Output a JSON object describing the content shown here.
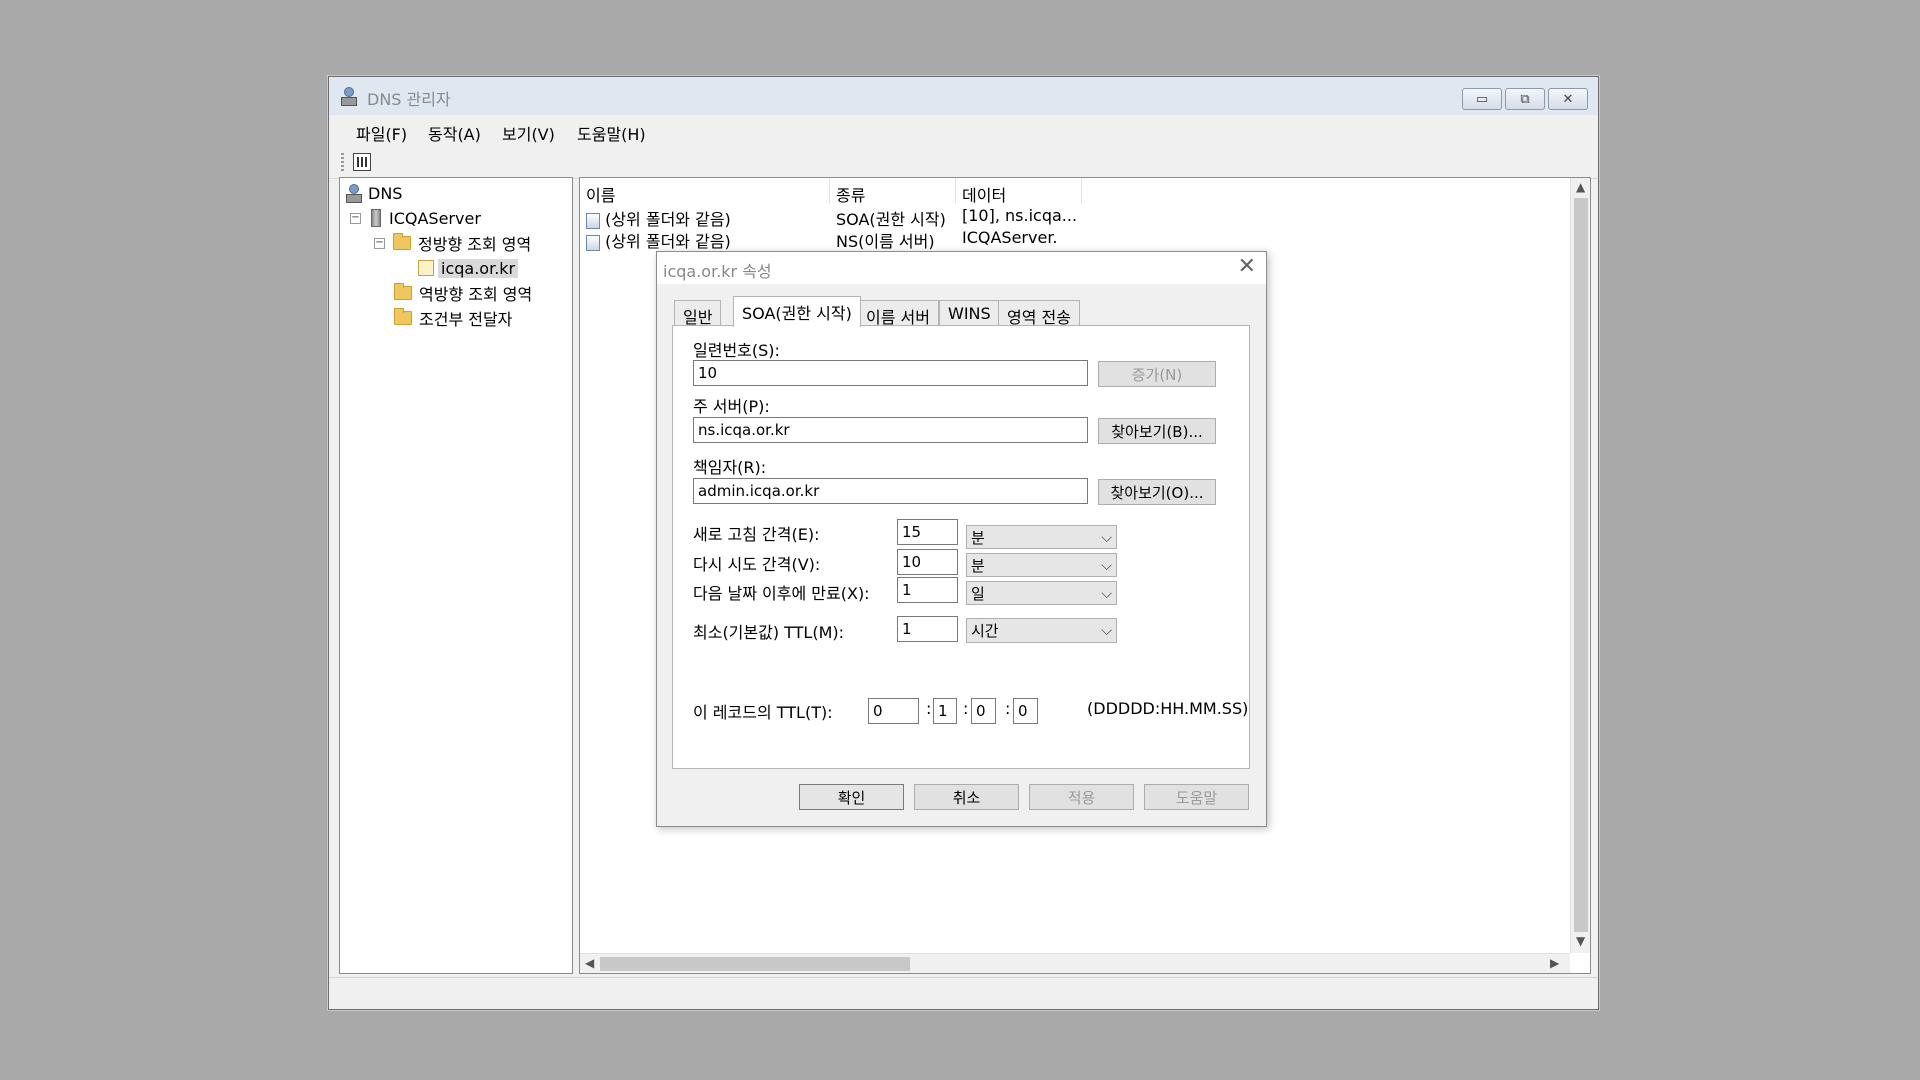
{
  "window": {
    "title": "DNS 관리자",
    "controls": {
      "minimize": "▭",
      "maximize": "⧉",
      "close": "✕"
    }
  },
  "menu": [
    "파일(F)",
    "동작(A)",
    "보기(V)",
    "도움말(H)"
  ],
  "tree": {
    "root": "DNS",
    "server": "ICQAServer",
    "forward_zones": "정방향 조회 영역",
    "selected_zone": "icqa.or.kr",
    "reverse_zones": "역방향 조회 영역",
    "conditional_forwarders": "조건부 전달자"
  },
  "list": {
    "columns": [
      "이름",
      "종류",
      "데이터"
    ],
    "rows": [
      {
        "name": "(상위 폴더와 같음)",
        "type": "SOA(권한 시작)",
        "data": "[10], ns.icqa..."
      },
      {
        "name": "(상위 폴더와 같음)",
        "type": "NS(이름 서버)",
        "data": "ICQAServer."
      }
    ]
  },
  "dialog": {
    "title": "icqa.or.kr 속성",
    "close": "✕",
    "tabs": [
      "일반",
      "SOA(권한 시작)",
      "이름 서버",
      "WINS",
      "영역 전송"
    ],
    "active_tab": "SOA(권한 시작)",
    "serial_label": "일련번호(S):",
    "serial_value": "10",
    "increment_button": "증가(N)",
    "primary_server_label": "주 서버(P):",
    "primary_server_value": "ns.icqa.or.kr",
    "browse_b_button": "찾아보기(B)...",
    "responsible_label": "책임자(R):",
    "responsible_value": "admin.icqa.or.kr",
    "browse_o_button": "찾아보기(O)...",
    "refresh_label": "새로 고침 간격(E):",
    "refresh_value": "15",
    "refresh_unit": "분",
    "retry_label": "다시 시도 간격(V):",
    "retry_value": "10",
    "retry_unit": "분",
    "expire_label": "다음 날짜 이후에 만료(X):",
    "expire_value": "1",
    "expire_unit": "일",
    "min_ttl_label": "최소(기본값) TTL(M):",
    "min_ttl_value": "1",
    "min_ttl_unit": "시간",
    "record_ttl_label": "이 레코드의 TTL(T):",
    "ttl_days": "0",
    "ttl_hours": "1",
    "ttl_minutes": "0",
    "ttl_seconds": "0",
    "ttl_sep": ":",
    "ttl_format": "(DDDDD:HH.MM.SS)",
    "ok_button": "확인",
    "cancel_button": "취소",
    "apply_button": "적용",
    "help_button": "도움말"
  }
}
